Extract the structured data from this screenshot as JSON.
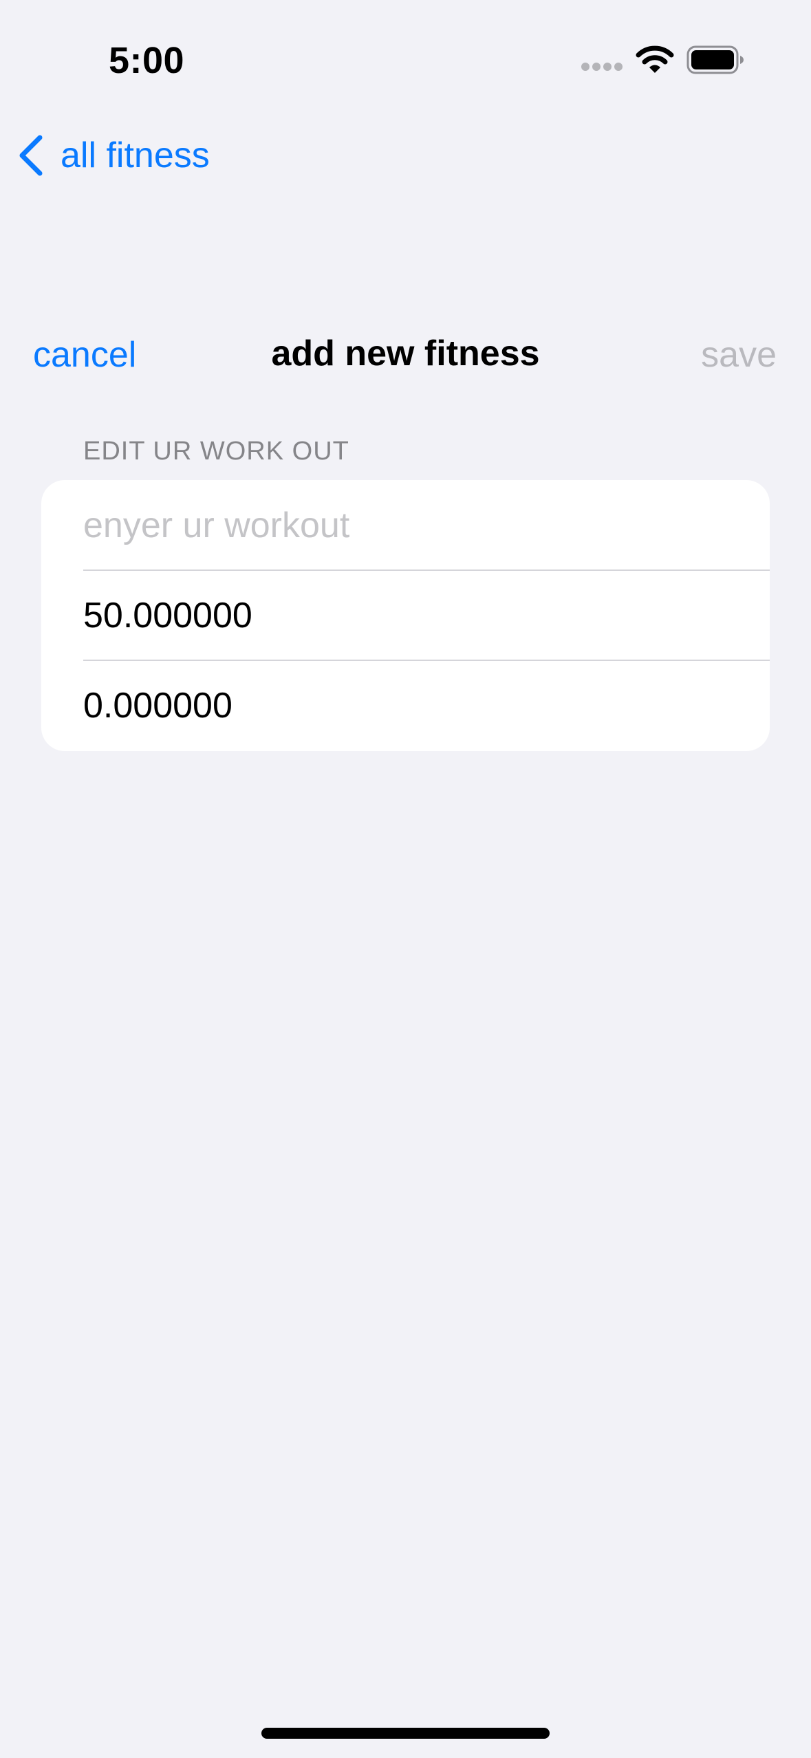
{
  "status_bar": {
    "time": "5:00",
    "icons": [
      "cellular-signal-icon",
      "wifi-icon",
      "battery-icon"
    ]
  },
  "navigation": {
    "back_label": "all fitness",
    "back_icon": "chevron-left-icon"
  },
  "sheet": {
    "title": "add new fitness",
    "cancel_label": "cancel",
    "save_label": "save",
    "save_enabled": false
  },
  "form": {
    "section_header": "EDIT UR WORK OUT",
    "workout_name": {
      "value": "",
      "placeholder": "enyer ur workout"
    },
    "value_1": {
      "value": "50.000000"
    },
    "value_2": {
      "value": "0.000000"
    }
  },
  "colors": {
    "background": "#f2f2f7",
    "accent": "#0a7aff",
    "disabled": "#b9b9be",
    "section_header": "#858589",
    "placeholder": "#c4c4c7",
    "card": "#ffffff"
  }
}
